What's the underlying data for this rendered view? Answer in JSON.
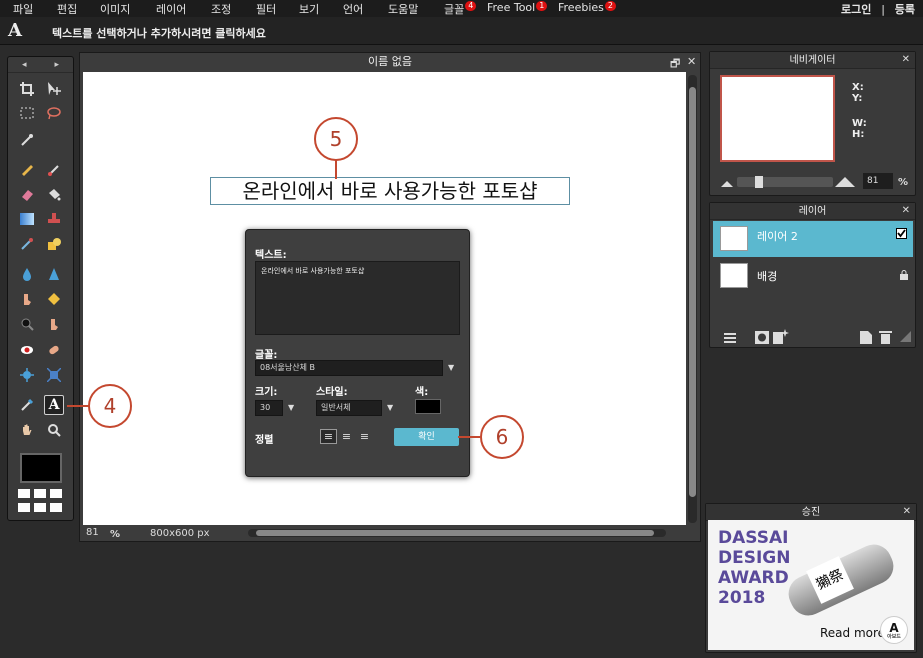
{
  "menu": {
    "items": [
      "파일",
      "편집",
      "이미지",
      "레이어",
      "조정",
      "필터",
      "보기",
      "언어",
      "도움말",
      "글꼴",
      "Free Tool",
      "Freebies"
    ],
    "badges": {
      "font": "4",
      "free_tool": "1",
      "freebies": "2"
    },
    "login": "로그인",
    "sep": "|",
    "register": "등록"
  },
  "options": {
    "tool_glyph": "A",
    "hint": "텍스트를 선택하거나 추가하시려면 클릭하세요"
  },
  "toolbox": {
    "prev": "◂",
    "next": "▸",
    "type_tool_glyph": "A"
  },
  "document": {
    "title": "이름 없음",
    "restore": "🗗",
    "close": "✕",
    "zoom": "81",
    "zoom_unit": "%",
    "size": "800x600 px"
  },
  "canvas_text": "온라인에서 바로 사용가능한 포토샵",
  "text_dialog": {
    "text_label": "텍스트:",
    "text_value": "온라인에서 바로 사용가능한 포토샵",
    "font_label": "글꼴:",
    "font_value": "08서울남산체 B",
    "size_label": "크기:",
    "size_value": "30",
    "style_label": "스타일:",
    "style_value": "일반서체",
    "color_label": "색:",
    "color_value": "#000000",
    "align_label": "정렬",
    "align_left": "≡",
    "align_center": "≡",
    "align_right": "≡",
    "ok": "확인"
  },
  "navigator": {
    "title": "네비게이터",
    "close": "✕",
    "x_label": "X:",
    "y_label": "Y:",
    "w_label": "W:",
    "h_label": "H:",
    "zoom": "81",
    "zoom_unit": "%"
  },
  "layers": {
    "title": "레이어",
    "close": "✕",
    "items": [
      {
        "name": "레이어 2",
        "selected": true,
        "checked": true
      },
      {
        "name": "배경",
        "selected": false,
        "locked": true
      }
    ]
  },
  "ad": {
    "title": "승진",
    "close": "✕",
    "headline": [
      "DASSAI",
      "DESIGN",
      "AWARD",
      "2018"
    ],
    "more": "Read more",
    "label_glyph": "獺祭",
    "logo_letter": "A",
    "logo_sub": "아보드"
  },
  "callouts": [
    "4",
    "5",
    "6"
  ],
  "colors": {
    "accent": "#5bb8cf",
    "callout": "#c4482f",
    "ad_text": "#5a4a9a",
    "badge": "#dd1111"
  }
}
